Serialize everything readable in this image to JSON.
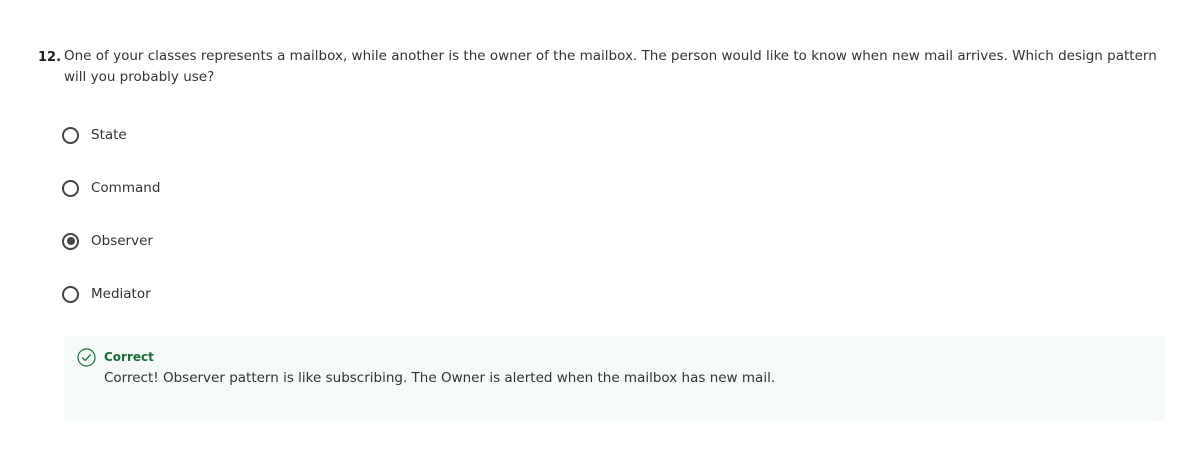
{
  "question": {
    "number": "12.",
    "text": "One of your classes represents a mailbox, while another is the owner of the mailbox. The person would like to know when new mail arrives. Which design pattern will you probably use?"
  },
  "options": [
    {
      "label": "State",
      "selected": false
    },
    {
      "label": "Command",
      "selected": false
    },
    {
      "label": "Observer",
      "selected": true
    },
    {
      "label": "Mediator",
      "selected": false
    }
  ],
  "feedback": {
    "status": "Correct",
    "message": "Correct! Observer pattern is like subscribing. The Owner is alerted when the mailbox has new mail.",
    "icon": "check-circle-icon",
    "accent_color": "#1f6b3d",
    "background_color": "#f5f9f7"
  }
}
